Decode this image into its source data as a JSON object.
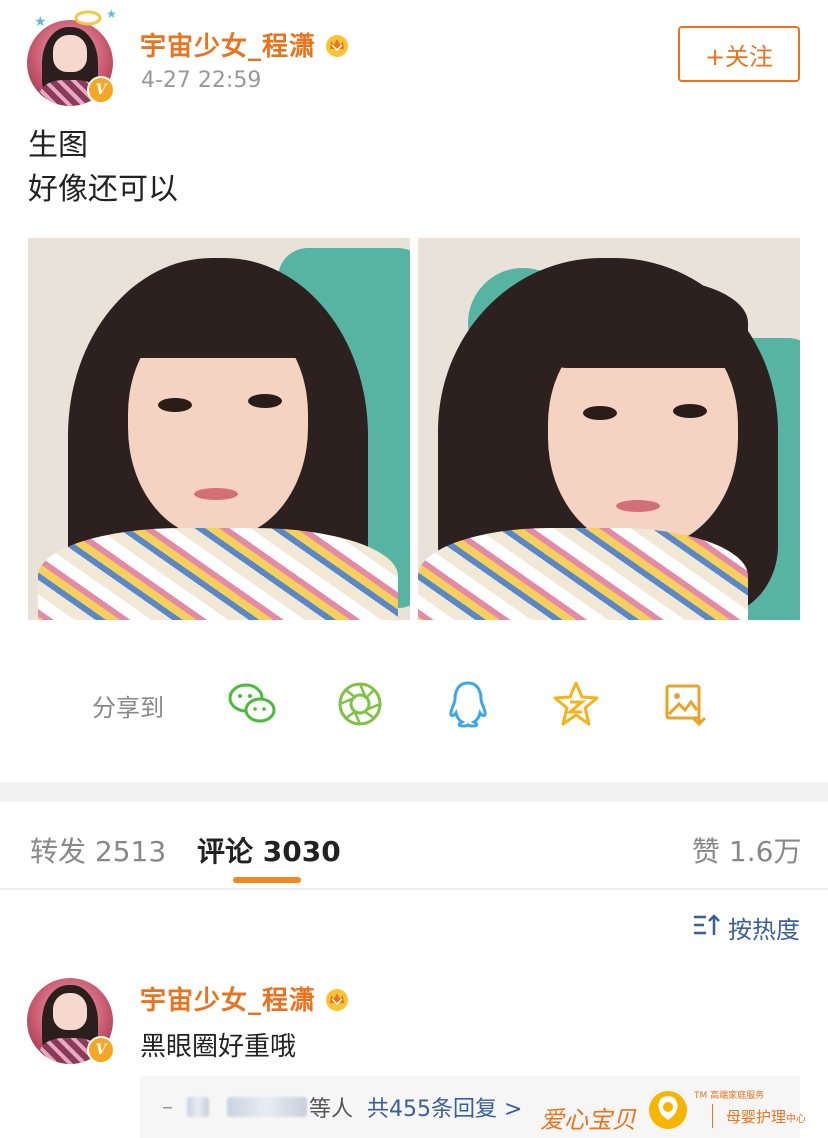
{
  "post": {
    "username": "宇宙少女_程潇",
    "timestamp": "4-27 22:59",
    "follow_label": "+关注",
    "text_lines": [
      "生图",
      "好像还可以"
    ]
  },
  "share": {
    "label": "分享到",
    "icons": [
      "wechat-icon",
      "moments-icon",
      "qq-icon",
      "qzone-icon",
      "save-image-icon"
    ]
  },
  "tabs": {
    "repost_label": "转发",
    "repost_count": "2513",
    "comment_label": "评论",
    "comment_count": "3030",
    "like_label": "赞",
    "like_count": "1.6万"
  },
  "sort": {
    "label": "按热度"
  },
  "comment": {
    "username": "宇宙少女_程潇",
    "text": "黑眼圈好重哦",
    "reply_suffix": "等人",
    "reply_link": "共455条回复",
    "reply_arrow": ">"
  },
  "watermark": {
    "brand": "爱心宝贝",
    "tm": "TM",
    "tagline": "高端家庭服务",
    "center": "母婴护理",
    "center_suffix": "中心"
  },
  "colors": {
    "accent": "#e8741f",
    "link": "#3b5f9a",
    "tab_underline": "#f08a1e"
  }
}
